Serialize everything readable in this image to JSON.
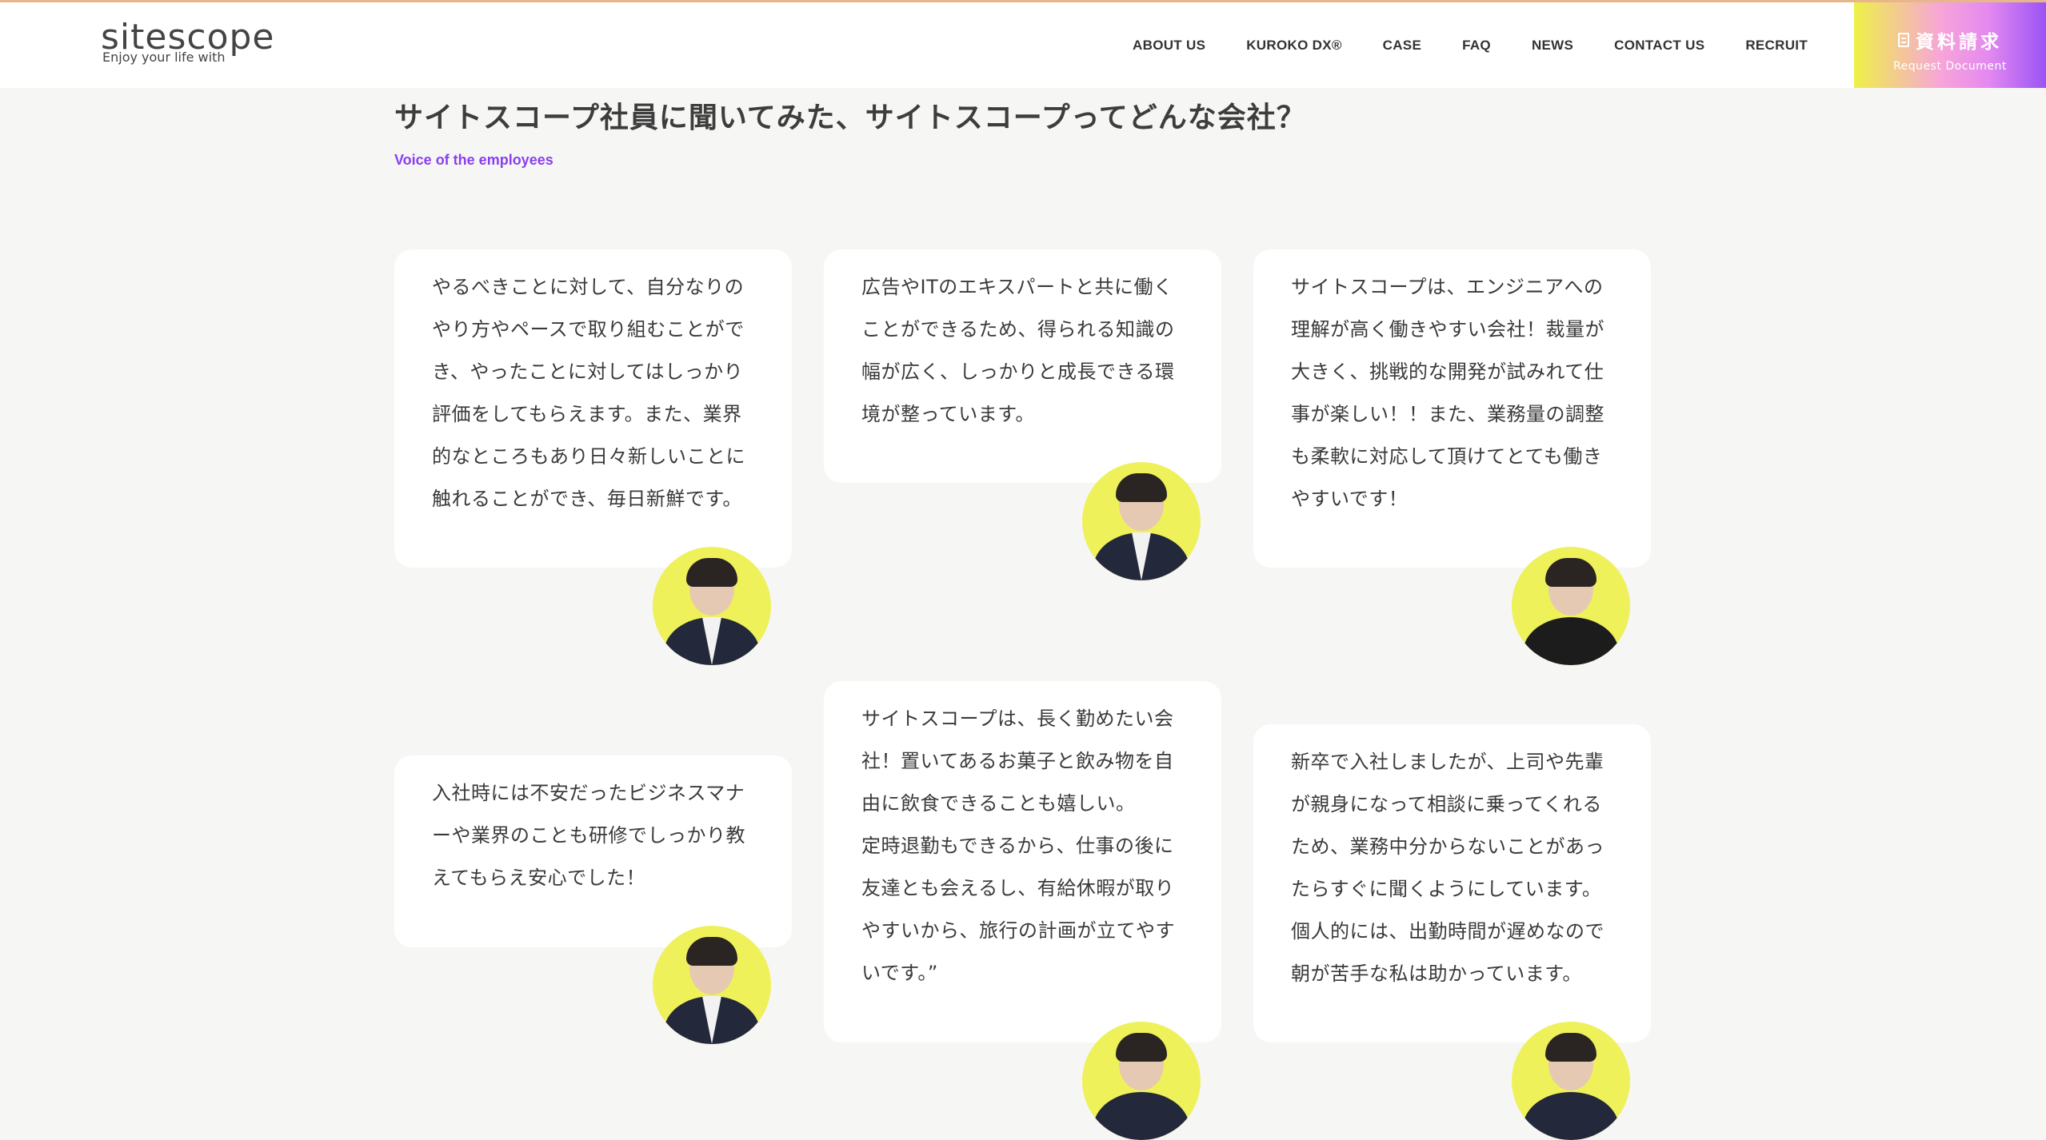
{
  "header": {
    "logo_main": "sitescope",
    "logo_tag": "Enjoy your life with",
    "nav": [
      "ABOUT US",
      "KUROKO DX®",
      "CASE",
      "FAQ",
      "NEWS",
      "CONTACT US",
      "RECRUIT"
    ],
    "cta_main": "資料請求",
    "cta_sub": "Request Document"
  },
  "section": {
    "title": "サイトスコープ社員に聞いてみた、サイトスコープってどんな会社？",
    "subtitle": "Voice of the employees"
  },
  "cards": [
    {
      "text": "やるべきことに対して、自分なりの\nやり方やペースで取り組むことがで\nき、やったことに対してはしっかり\n評価をしてもらえます。また、業界\n的なところもあり日々新しいことに\n触れることができ、毎日新鮮です。"
    },
    {
      "text": "広告やITのエキスパートと共に働く\nことができるため、得られる知識の\n幅が広く、しっかりと成長できる環\n境が整っています。"
    },
    {
      "text": "サイトスコープは、エンジニアへの\n理解が高く働きやすい会社！裁量が\n大きく、挑戦的な開発が試みれて仕\n事が楽しい！！また、業務量の調整\nも柔軟に対応して頂けてとても働き\nやすいです！"
    },
    {
      "text": "入社時には不安だったビジネスマナ\nーや業界のことも研修でしっかり教\nえてもらえ安心でした！"
    },
    {
      "text": "サイトスコープは、長く勤めたい会\n社！置いてあるお菓子と飲み物を自\n由に飲食できることも嬉しい。\n定時退勤もできるから、仕事の後に\n友達とも会えるし、有給休暇が取り\nやすいから、旅行の計画が立てやす\nいです。”"
    },
    {
      "text": "新卒で入社しましたが、上司や先輩\nが親身になって相談に乗ってくれる\nため、業務中分からないことがあっ\nたらすぐに聞くようにしています。\n個人的には、出勤時間が遅めなので\n朝が苦手な私は助かっています。"
    }
  ],
  "colors": {
    "accent_purple": "#8a3ff0",
    "avatar_bg": "#eef15a",
    "page_bg": "#f6f6f4"
  }
}
